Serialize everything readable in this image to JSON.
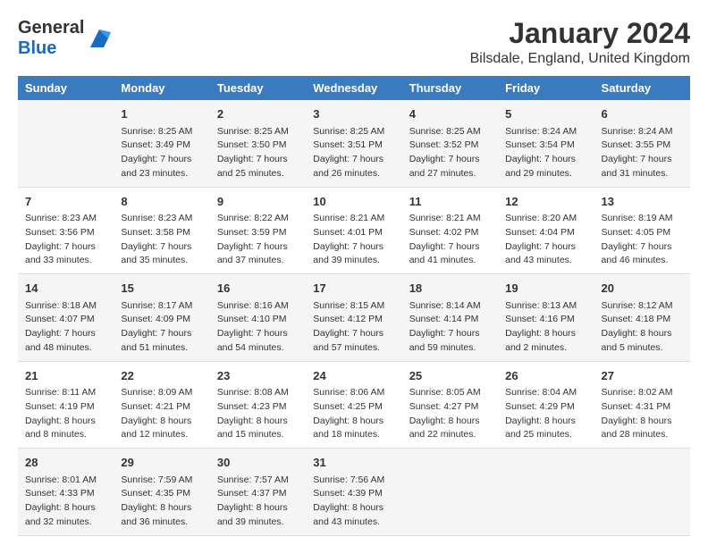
{
  "header": {
    "logo_general": "General",
    "logo_blue": "Blue",
    "title": "January 2024",
    "subtitle": "Bilsdale, England, United Kingdom"
  },
  "days_of_week": [
    "Sunday",
    "Monday",
    "Tuesday",
    "Wednesday",
    "Thursday",
    "Friday",
    "Saturday"
  ],
  "weeks": [
    [
      {
        "day": "",
        "sunrise": "",
        "sunset": "",
        "daylight": ""
      },
      {
        "day": "1",
        "sunrise": "Sunrise: 8:25 AM",
        "sunset": "Sunset: 3:49 PM",
        "daylight": "Daylight: 7 hours and 23 minutes."
      },
      {
        "day": "2",
        "sunrise": "Sunrise: 8:25 AM",
        "sunset": "Sunset: 3:50 PM",
        "daylight": "Daylight: 7 hours and 25 minutes."
      },
      {
        "day": "3",
        "sunrise": "Sunrise: 8:25 AM",
        "sunset": "Sunset: 3:51 PM",
        "daylight": "Daylight: 7 hours and 26 minutes."
      },
      {
        "day": "4",
        "sunrise": "Sunrise: 8:25 AM",
        "sunset": "Sunset: 3:52 PM",
        "daylight": "Daylight: 7 hours and 27 minutes."
      },
      {
        "day": "5",
        "sunrise": "Sunrise: 8:24 AM",
        "sunset": "Sunset: 3:54 PM",
        "daylight": "Daylight: 7 hours and 29 minutes."
      },
      {
        "day": "6",
        "sunrise": "Sunrise: 8:24 AM",
        "sunset": "Sunset: 3:55 PM",
        "daylight": "Daylight: 7 hours and 31 minutes."
      }
    ],
    [
      {
        "day": "7",
        "sunrise": "Sunrise: 8:23 AM",
        "sunset": "Sunset: 3:56 PM",
        "daylight": "Daylight: 7 hours and 33 minutes."
      },
      {
        "day": "8",
        "sunrise": "Sunrise: 8:23 AM",
        "sunset": "Sunset: 3:58 PM",
        "daylight": "Daylight: 7 hours and 35 minutes."
      },
      {
        "day": "9",
        "sunrise": "Sunrise: 8:22 AM",
        "sunset": "Sunset: 3:59 PM",
        "daylight": "Daylight: 7 hours and 37 minutes."
      },
      {
        "day": "10",
        "sunrise": "Sunrise: 8:21 AM",
        "sunset": "Sunset: 4:01 PM",
        "daylight": "Daylight: 7 hours and 39 minutes."
      },
      {
        "day": "11",
        "sunrise": "Sunrise: 8:21 AM",
        "sunset": "Sunset: 4:02 PM",
        "daylight": "Daylight: 7 hours and 41 minutes."
      },
      {
        "day": "12",
        "sunrise": "Sunrise: 8:20 AM",
        "sunset": "Sunset: 4:04 PM",
        "daylight": "Daylight: 7 hours and 43 minutes."
      },
      {
        "day": "13",
        "sunrise": "Sunrise: 8:19 AM",
        "sunset": "Sunset: 4:05 PM",
        "daylight": "Daylight: 7 hours and 46 minutes."
      }
    ],
    [
      {
        "day": "14",
        "sunrise": "Sunrise: 8:18 AM",
        "sunset": "Sunset: 4:07 PM",
        "daylight": "Daylight: 7 hours and 48 minutes."
      },
      {
        "day": "15",
        "sunrise": "Sunrise: 8:17 AM",
        "sunset": "Sunset: 4:09 PM",
        "daylight": "Daylight: 7 hours and 51 minutes."
      },
      {
        "day": "16",
        "sunrise": "Sunrise: 8:16 AM",
        "sunset": "Sunset: 4:10 PM",
        "daylight": "Daylight: 7 hours and 54 minutes."
      },
      {
        "day": "17",
        "sunrise": "Sunrise: 8:15 AM",
        "sunset": "Sunset: 4:12 PM",
        "daylight": "Daylight: 7 hours and 57 minutes."
      },
      {
        "day": "18",
        "sunrise": "Sunrise: 8:14 AM",
        "sunset": "Sunset: 4:14 PM",
        "daylight": "Daylight: 7 hours and 59 minutes."
      },
      {
        "day": "19",
        "sunrise": "Sunrise: 8:13 AM",
        "sunset": "Sunset: 4:16 PM",
        "daylight": "Daylight: 8 hours and 2 minutes."
      },
      {
        "day": "20",
        "sunrise": "Sunrise: 8:12 AM",
        "sunset": "Sunset: 4:18 PM",
        "daylight": "Daylight: 8 hours and 5 minutes."
      }
    ],
    [
      {
        "day": "21",
        "sunrise": "Sunrise: 8:11 AM",
        "sunset": "Sunset: 4:19 PM",
        "daylight": "Daylight: 8 hours and 8 minutes."
      },
      {
        "day": "22",
        "sunrise": "Sunrise: 8:09 AM",
        "sunset": "Sunset: 4:21 PM",
        "daylight": "Daylight: 8 hours and 12 minutes."
      },
      {
        "day": "23",
        "sunrise": "Sunrise: 8:08 AM",
        "sunset": "Sunset: 4:23 PM",
        "daylight": "Daylight: 8 hours and 15 minutes."
      },
      {
        "day": "24",
        "sunrise": "Sunrise: 8:06 AM",
        "sunset": "Sunset: 4:25 PM",
        "daylight": "Daylight: 8 hours and 18 minutes."
      },
      {
        "day": "25",
        "sunrise": "Sunrise: 8:05 AM",
        "sunset": "Sunset: 4:27 PM",
        "daylight": "Daylight: 8 hours and 22 minutes."
      },
      {
        "day": "26",
        "sunrise": "Sunrise: 8:04 AM",
        "sunset": "Sunset: 4:29 PM",
        "daylight": "Daylight: 8 hours and 25 minutes."
      },
      {
        "day": "27",
        "sunrise": "Sunrise: 8:02 AM",
        "sunset": "Sunset: 4:31 PM",
        "daylight": "Daylight: 8 hours and 28 minutes."
      }
    ],
    [
      {
        "day": "28",
        "sunrise": "Sunrise: 8:01 AM",
        "sunset": "Sunset: 4:33 PM",
        "daylight": "Daylight: 8 hours and 32 minutes."
      },
      {
        "day": "29",
        "sunrise": "Sunrise: 7:59 AM",
        "sunset": "Sunset: 4:35 PM",
        "daylight": "Daylight: 8 hours and 36 minutes."
      },
      {
        "day": "30",
        "sunrise": "Sunrise: 7:57 AM",
        "sunset": "Sunset: 4:37 PM",
        "daylight": "Daylight: 8 hours and 39 minutes."
      },
      {
        "day": "31",
        "sunrise": "Sunrise: 7:56 AM",
        "sunset": "Sunset: 4:39 PM",
        "daylight": "Daylight: 8 hours and 43 minutes."
      },
      {
        "day": "",
        "sunrise": "",
        "sunset": "",
        "daylight": ""
      },
      {
        "day": "",
        "sunrise": "",
        "sunset": "",
        "daylight": ""
      },
      {
        "day": "",
        "sunrise": "",
        "sunset": "",
        "daylight": ""
      }
    ]
  ]
}
